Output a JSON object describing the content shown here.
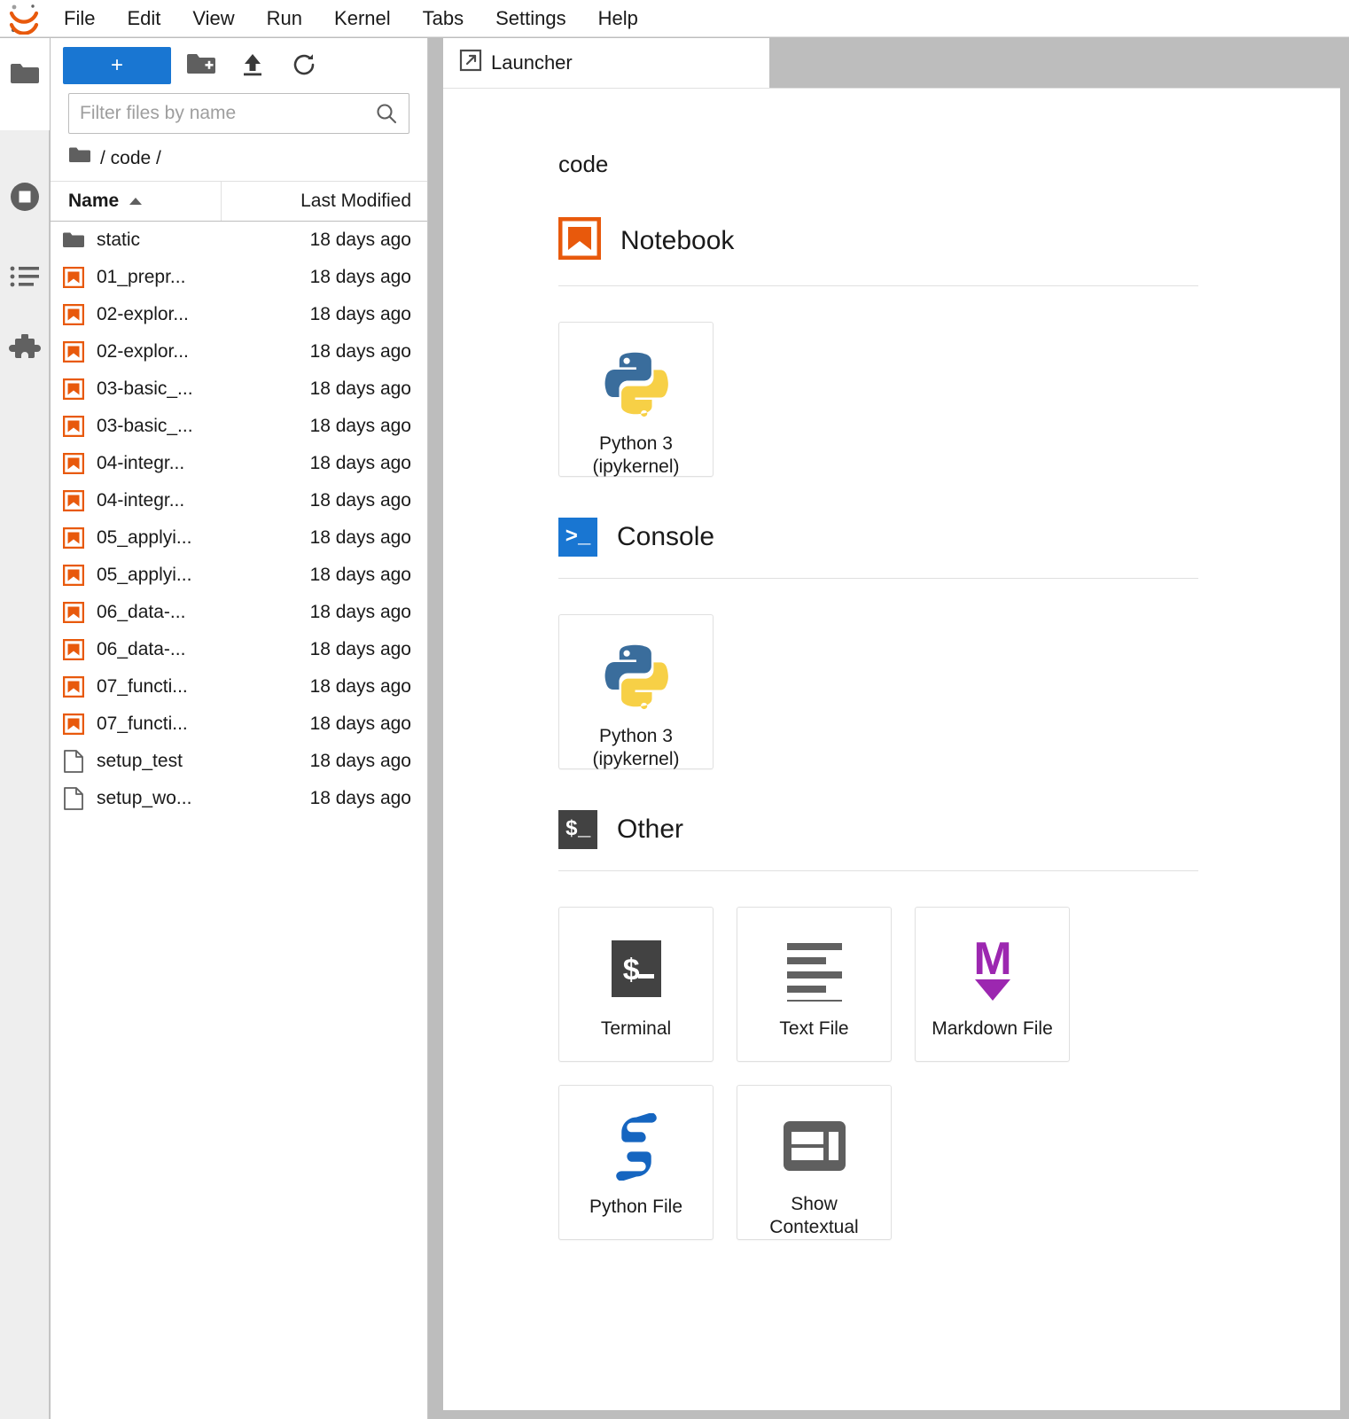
{
  "app": {
    "name": "JupyterLab",
    "logo_icon": "jupyter-logo-icon",
    "accent_blue": "#1976d2",
    "notebook_orange": "#e8590c",
    "markdown_purple": "#9c27b0"
  },
  "menubar": {
    "items": [
      {
        "label": "File"
      },
      {
        "label": "Edit"
      },
      {
        "label": "View"
      },
      {
        "label": "Run"
      },
      {
        "label": "Kernel"
      },
      {
        "label": "Tabs"
      },
      {
        "label": "Settings"
      },
      {
        "label": "Help"
      }
    ]
  },
  "activitybar": {
    "items": [
      {
        "name": "file-browser",
        "icon": "folder-icon",
        "active": true
      },
      {
        "name": "running-terminals-and-kernels",
        "icon": "stop-circle-icon",
        "active": false
      },
      {
        "name": "table-of-contents",
        "icon": "list-icon",
        "active": false
      },
      {
        "name": "extension-manager",
        "icon": "puzzle-piece-icon",
        "active": false
      }
    ]
  },
  "filebrowser": {
    "toolbar": {
      "new_launcher_label": "+",
      "new_folder_icon": "new-folder-icon",
      "upload_icon": "upload-icon",
      "refresh_icon": "refresh-icon"
    },
    "filter": {
      "placeholder": "Filter files by name",
      "value": "",
      "search_icon": "search-icon"
    },
    "breadcrumb": {
      "root_icon": "folder-icon",
      "path": "/ code /"
    },
    "columns": {
      "name": "Name",
      "last_modified": "Last Modified",
      "sort_direction": "ascending",
      "sort_icon": "caret-up-icon"
    },
    "rows": [
      {
        "icon": "folder-icon",
        "name": "static",
        "modified": "18 days ago"
      },
      {
        "icon": "notebook-icon",
        "name": "01_prepr...",
        "modified": "18 days ago"
      },
      {
        "icon": "notebook-icon",
        "name": "02-explor...",
        "modified": "18 days ago"
      },
      {
        "icon": "notebook-icon",
        "name": "02-explor...",
        "modified": "18 days ago"
      },
      {
        "icon": "notebook-icon",
        "name": "03-basic_...",
        "modified": "18 days ago"
      },
      {
        "icon": "notebook-icon",
        "name": "03-basic_...",
        "modified": "18 days ago"
      },
      {
        "icon": "notebook-icon",
        "name": "04-integr...",
        "modified": "18 days ago"
      },
      {
        "icon": "notebook-icon",
        "name": "04-integr...",
        "modified": "18 days ago"
      },
      {
        "icon": "notebook-icon",
        "name": "05_applyi...",
        "modified": "18 days ago"
      },
      {
        "icon": "notebook-icon",
        "name": "05_applyi...",
        "modified": "18 days ago"
      },
      {
        "icon": "notebook-icon",
        "name": "06_data-...",
        "modified": "18 days ago"
      },
      {
        "icon": "notebook-icon",
        "name": "06_data-...",
        "modified": "18 days ago"
      },
      {
        "icon": "notebook-icon",
        "name": "07_functi...",
        "modified": "18 days ago"
      },
      {
        "icon": "notebook-icon",
        "name": "07_functi...",
        "modified": "18 days ago"
      },
      {
        "icon": "file-icon",
        "name": "setup_test",
        "modified": "18 days ago"
      },
      {
        "icon": "file-icon",
        "name": "setup_wo...",
        "modified": "18 days ago"
      }
    ]
  },
  "dock": {
    "tabs": [
      {
        "label": "Launcher",
        "icon": "launcher-icon",
        "active": true
      }
    ]
  },
  "launcher": {
    "cwd": "code",
    "sections": [
      {
        "title": "Notebook",
        "icon": "notebook-icon",
        "cards": [
          {
            "label": "Python 3\n(ipykernel)",
            "icon": "python-logo-icon"
          }
        ]
      },
      {
        "title": "Console",
        "icon": "console-icon",
        "cards": [
          {
            "label": "Python 3\n(ipykernel)",
            "icon": "python-logo-icon"
          }
        ]
      },
      {
        "title": "Other",
        "icon": "terminal-icon",
        "cards": [
          {
            "label": "Terminal",
            "icon": "terminal-icon"
          },
          {
            "label": "Text File",
            "icon": "text-file-icon"
          },
          {
            "label": "Markdown File",
            "icon": "markdown-icon"
          },
          {
            "label": "Python File",
            "icon": "python-file-icon"
          },
          {
            "label": "Show\nContextual",
            "icon": "contextual-help-icon"
          }
        ]
      }
    ]
  }
}
